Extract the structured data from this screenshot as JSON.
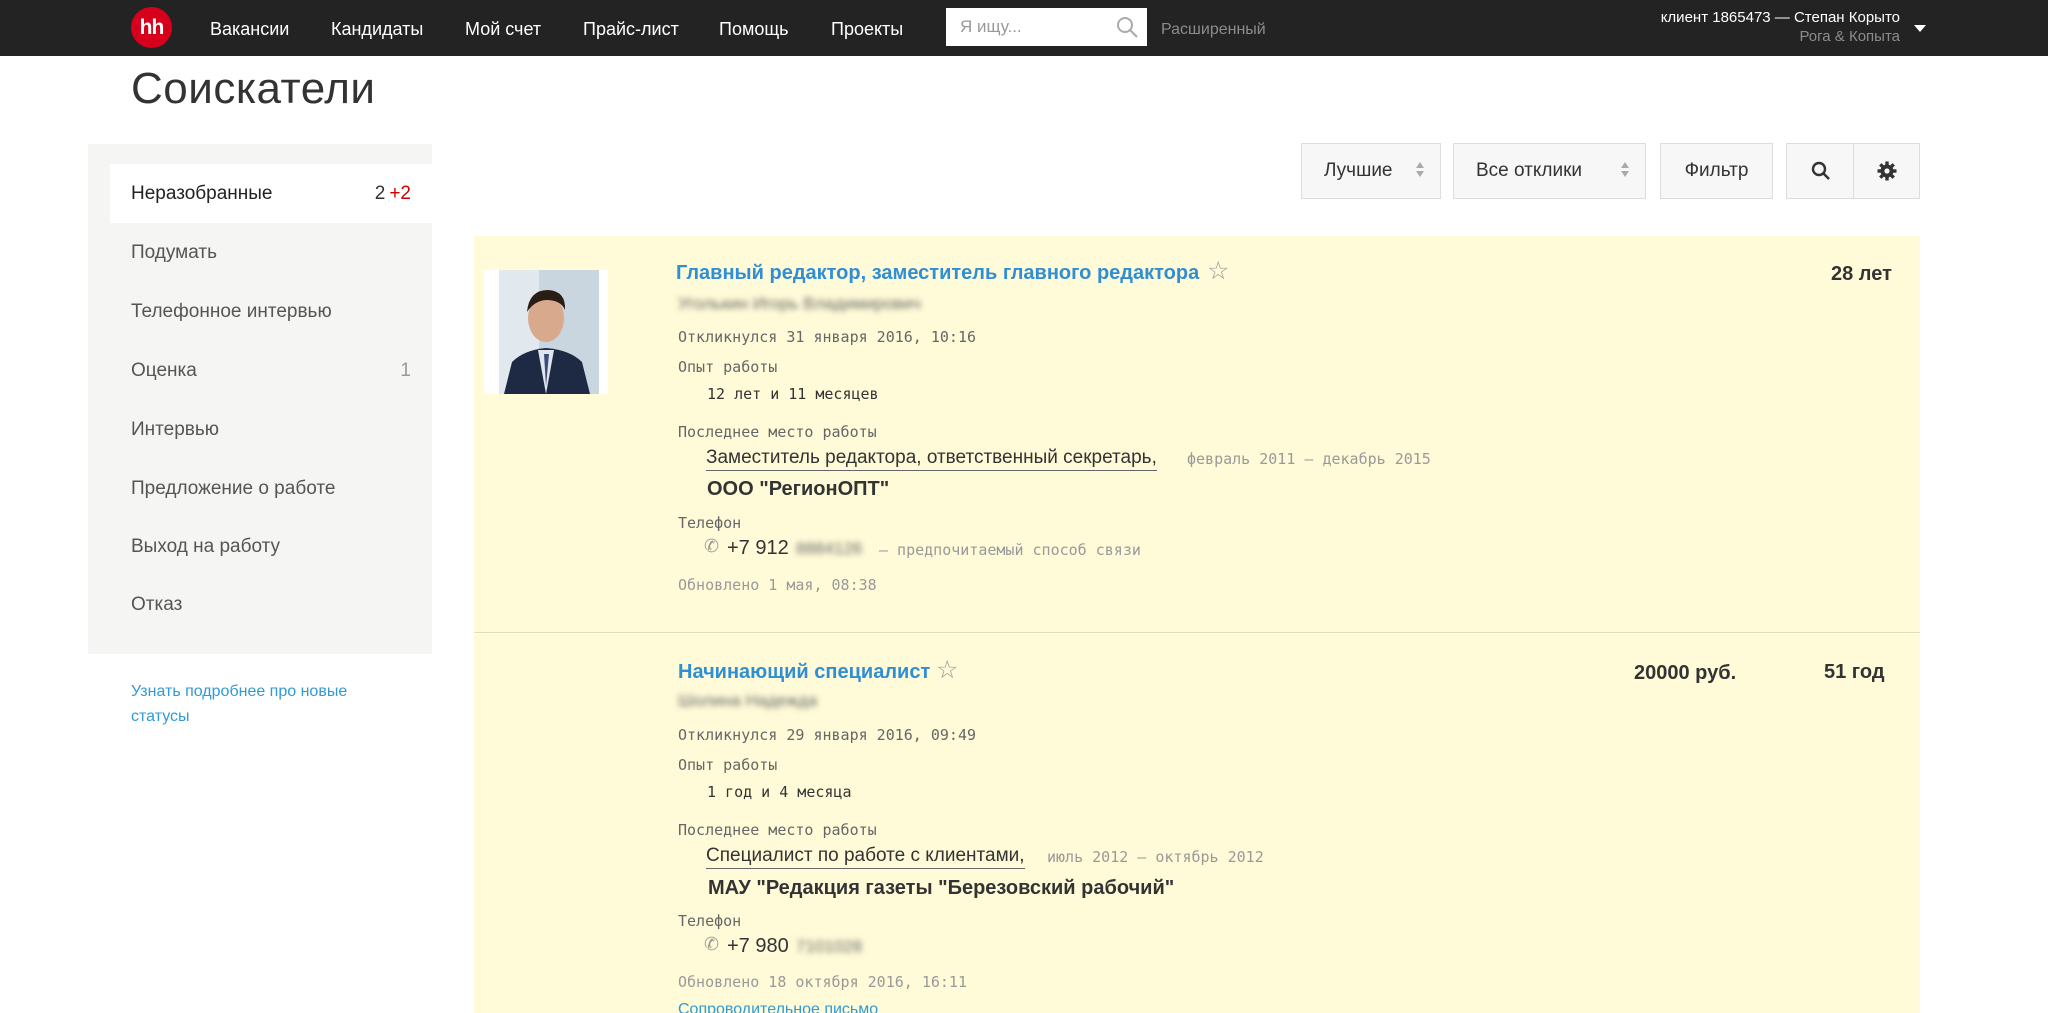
{
  "header": {
    "logo": "hh",
    "nav": [
      "Вакансии",
      "Кандидаты",
      "Мой счет",
      "Прайс-лист",
      "Помощь",
      "Проекты"
    ],
    "search_placeholder": "Я ищу...",
    "advanced": "Расширенный",
    "account_name": "клиент 1865473 — Степан Корыто",
    "account_company": "Рога & Копыта"
  },
  "page_title": "Соискатели",
  "sidebar": {
    "items": [
      {
        "label": "Неразобранные",
        "count": "2",
        "new": "+2"
      },
      {
        "label": "Подумать",
        "count": "",
        "new": ""
      },
      {
        "label": "Телефонное интервью",
        "count": "",
        "new": ""
      },
      {
        "label": "Оценка",
        "count": "1",
        "new": ""
      },
      {
        "label": "Интервью",
        "count": "",
        "new": ""
      },
      {
        "label": "Предложение о работе",
        "count": "",
        "new": ""
      },
      {
        "label": "Выход на работу",
        "count": "",
        "new": ""
      },
      {
        "label": "Отказ",
        "count": "",
        "new": ""
      }
    ],
    "link": "Узнать подробнее про новые статусы"
  },
  "toolbar": {
    "sort": "Лучшие",
    "responses": "Все отклики",
    "filter": "Фильтр"
  },
  "candidates": [
    {
      "position": "Главный редактор, заместитель главного редактора",
      "name_blurred": "Уголькин Игорь Владимирович",
      "responded": "Откликнулся 31 января 2016, 10:16",
      "experience_label": "Опыт работы",
      "experience": "12 лет и 11 месяцев",
      "last_job_label": "Последнее место работы",
      "last_job_title": "Заместитель редактора, ответственный секретарь,",
      "last_job_period": "февраль 2011 — декабрь 2015",
      "last_job_company": "ООО \"РегионОПТ\"",
      "phone_label": "Телефон",
      "phone_prefix": "+7 912",
      "phone_hidden": "8884126",
      "phone_note": "— предпочитаемый способ связи",
      "updated": "Обновлено 1 мая, 08:38",
      "salary": "",
      "age": "28 лет"
    },
    {
      "position": "Начинающий специалист",
      "name_blurred": "Шолина Надежда",
      "responded": "Откликнулся 29 января 2016, 09:49",
      "experience_label": "Опыт работы",
      "experience": "1 год и 4 месяца",
      "last_job_label": "Последнее место работы",
      "last_job_title": "Специалист по работе с клиентами,",
      "last_job_period": "июль 2012 — октябрь 2012",
      "last_job_company": "МАУ \"Редакция газеты \"Березовский рабочий\"",
      "phone_label": "Телефон",
      "phone_prefix": "+7 980",
      "phone_hidden": "7101028",
      "phone_note": "",
      "updated": "Обновлено 18 октября 2016, 16:11",
      "cover_letter": "Сопроводительное письмо",
      "salary": "20000 руб.",
      "age": "51 год"
    }
  ]
}
